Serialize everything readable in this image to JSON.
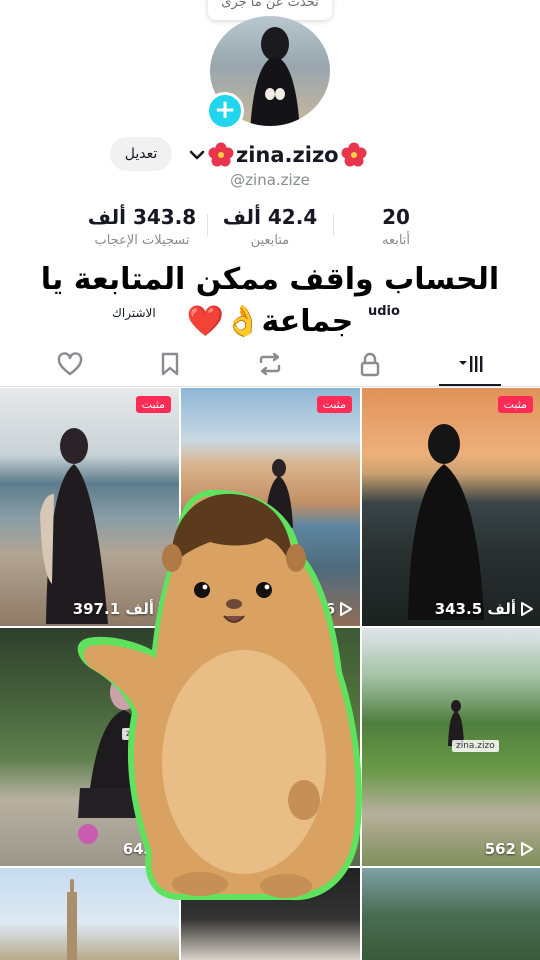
{
  "header": {
    "bubble_text": "تحدث عن ما جرى",
    "edit_label": "تعديل",
    "username": "zina.zizo",
    "handle": "@zina.zize"
  },
  "stats": {
    "following": {
      "value": "20",
      "label": "أتابعه"
    },
    "followers": {
      "value": "42.4 ألف",
      "label": "متابعين"
    },
    "likes": {
      "value": "343.8 ألف",
      "label": "تسجيلات الإعجاب"
    }
  },
  "overlay": {
    "line1": "الحساب واقف ممكن المتابعة يا",
    "line2": "جماعة👌❤️",
    "partial_left": "الاشتراك",
    "partial_right": "udio"
  },
  "tabs": [
    {
      "icon": "grid-icon",
      "active": true
    },
    {
      "icon": "lock-icon",
      "active": false
    },
    {
      "icon": "repost-icon",
      "active": false
    },
    {
      "icon": "bookmark-icon",
      "active": false
    },
    {
      "icon": "heart-icon",
      "active": false
    }
  ],
  "videos": [
    {
      "pinned": "مثبت",
      "views": "397.1 ألف"
    },
    {
      "pinned": "مثبت",
      "views": "6"
    },
    {
      "pinned": "مثبت",
      "views": "343.5 ألف"
    },
    {
      "watermark": "zina.zizo",
      "views": "643"
    },
    {
      "views": ""
    },
    {
      "watermark": "zina.zizo",
      "views": "562"
    },
    {
      "views": ""
    },
    {
      "views": ""
    },
    {
      "views": ""
    }
  ],
  "colors": {
    "accent": "#fe2c55",
    "add_button": "#20d5ec",
    "text_primary": "#161823",
    "text_secondary": "#8a8b91"
  }
}
